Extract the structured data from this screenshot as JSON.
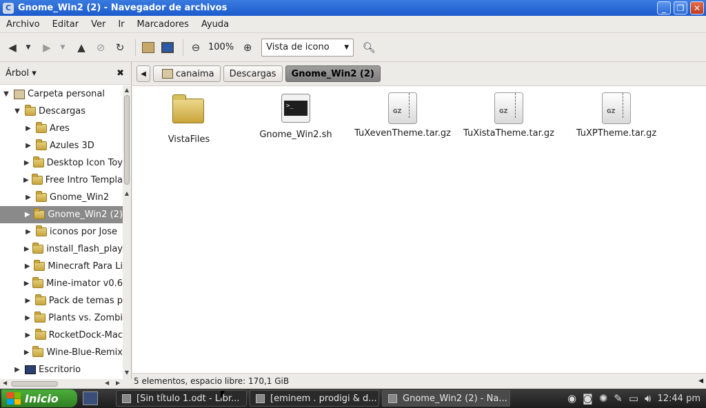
{
  "window": {
    "title": "Gnome_Win2 (2) - Navegador de archivos",
    "app_icon": "C",
    "buttons": {
      "minimize": "_",
      "maximize": "❐",
      "close": "✕"
    }
  },
  "menubar": {
    "items": [
      "Archivo",
      "Editar",
      "Ver",
      "Ir",
      "Marcadores",
      "Ayuda"
    ]
  },
  "toolbar": {
    "zoom_level": "100%",
    "view_mode": "Vista de icono",
    "icons": [
      "back-arrow-icon",
      "forward-arrow-icon",
      "up-arrow-icon",
      "stop-icon",
      "reload-icon",
      "home-icon",
      "computer-icon",
      "zoom-out-icon",
      "zoom-in-icon",
      "search-icon"
    ]
  },
  "sidebar": {
    "header": "Árbol ▾",
    "close": "✖",
    "tree": [
      {
        "label": "Carpeta personal",
        "level": 0,
        "expander": "▼",
        "icon": "home"
      },
      {
        "label": "Descargas",
        "level": 1,
        "expander": "▼",
        "icon": "folder"
      },
      {
        "label": "Ares",
        "level": 2,
        "expander": "▶",
        "icon": "folder"
      },
      {
        "label": "Azules 3D",
        "level": 2,
        "expander": "▶",
        "icon": "folder"
      },
      {
        "label": "Desktop Icon Toy",
        "level": 2,
        "expander": "▶",
        "icon": "folder"
      },
      {
        "label": "Free Intro Templa",
        "level": 2,
        "expander": "▶",
        "icon": "folder"
      },
      {
        "label": "Gnome_Win2",
        "level": 2,
        "expander": "▶",
        "icon": "folder"
      },
      {
        "label": "Gnome_Win2 (2)",
        "level": 2,
        "expander": "▶",
        "icon": "folder",
        "selected": true
      },
      {
        "label": "iconos por Jose",
        "level": 2,
        "expander": "▶",
        "icon": "folder"
      },
      {
        "label": "install_flash_play",
        "level": 2,
        "expander": "▶",
        "icon": "folder"
      },
      {
        "label": "Minecraft Para Li",
        "level": 2,
        "expander": "▶",
        "icon": "folder"
      },
      {
        "label": "Mine-imator v0.6",
        "level": 2,
        "expander": "▶",
        "icon": "folder"
      },
      {
        "label": "Pack de temas p",
        "level": 2,
        "expander": "▶",
        "icon": "folder"
      },
      {
        "label": "Plants vs. Zombi",
        "level": 2,
        "expander": "▶",
        "icon": "folder"
      },
      {
        "label": "RocketDock-Mac",
        "level": 2,
        "expander": "▶",
        "icon": "folder"
      },
      {
        "label": "Wine-Blue-Remix",
        "level": 2,
        "expander": "▶",
        "icon": "folder"
      },
      {
        "label": "Escritorio",
        "level": 1,
        "expander": "▶",
        "icon": "desktop"
      }
    ]
  },
  "pathbar": {
    "crumbs": [
      "canaima",
      "Descargas",
      "Gnome_Win2 (2)"
    ]
  },
  "files": [
    {
      "name": "VistaFiles",
      "type": "folder"
    },
    {
      "name": "Gnome_Win2.sh",
      "type": "script",
      "glyph": ">_"
    },
    {
      "name": "TuXevenTheme.tar.gz",
      "type": "archive",
      "glyph": "GZ"
    },
    {
      "name": "TuXistaTheme.tar.gz",
      "type": "archive",
      "glyph": "GZ"
    },
    {
      "name": "TuXPTheme.tar.gz",
      "type": "archive",
      "glyph": "GZ"
    }
  ],
  "status": "5 elementos, espacio libre: 170,1 GiB",
  "taskbar": {
    "start": "Inicio",
    "tasks": [
      "[Sin título 1.odt - Libr...",
      "[eminem . prodigi & d...",
      "Gnome_Win2 (2) - Na..."
    ],
    "clock": "12:44 pm"
  }
}
